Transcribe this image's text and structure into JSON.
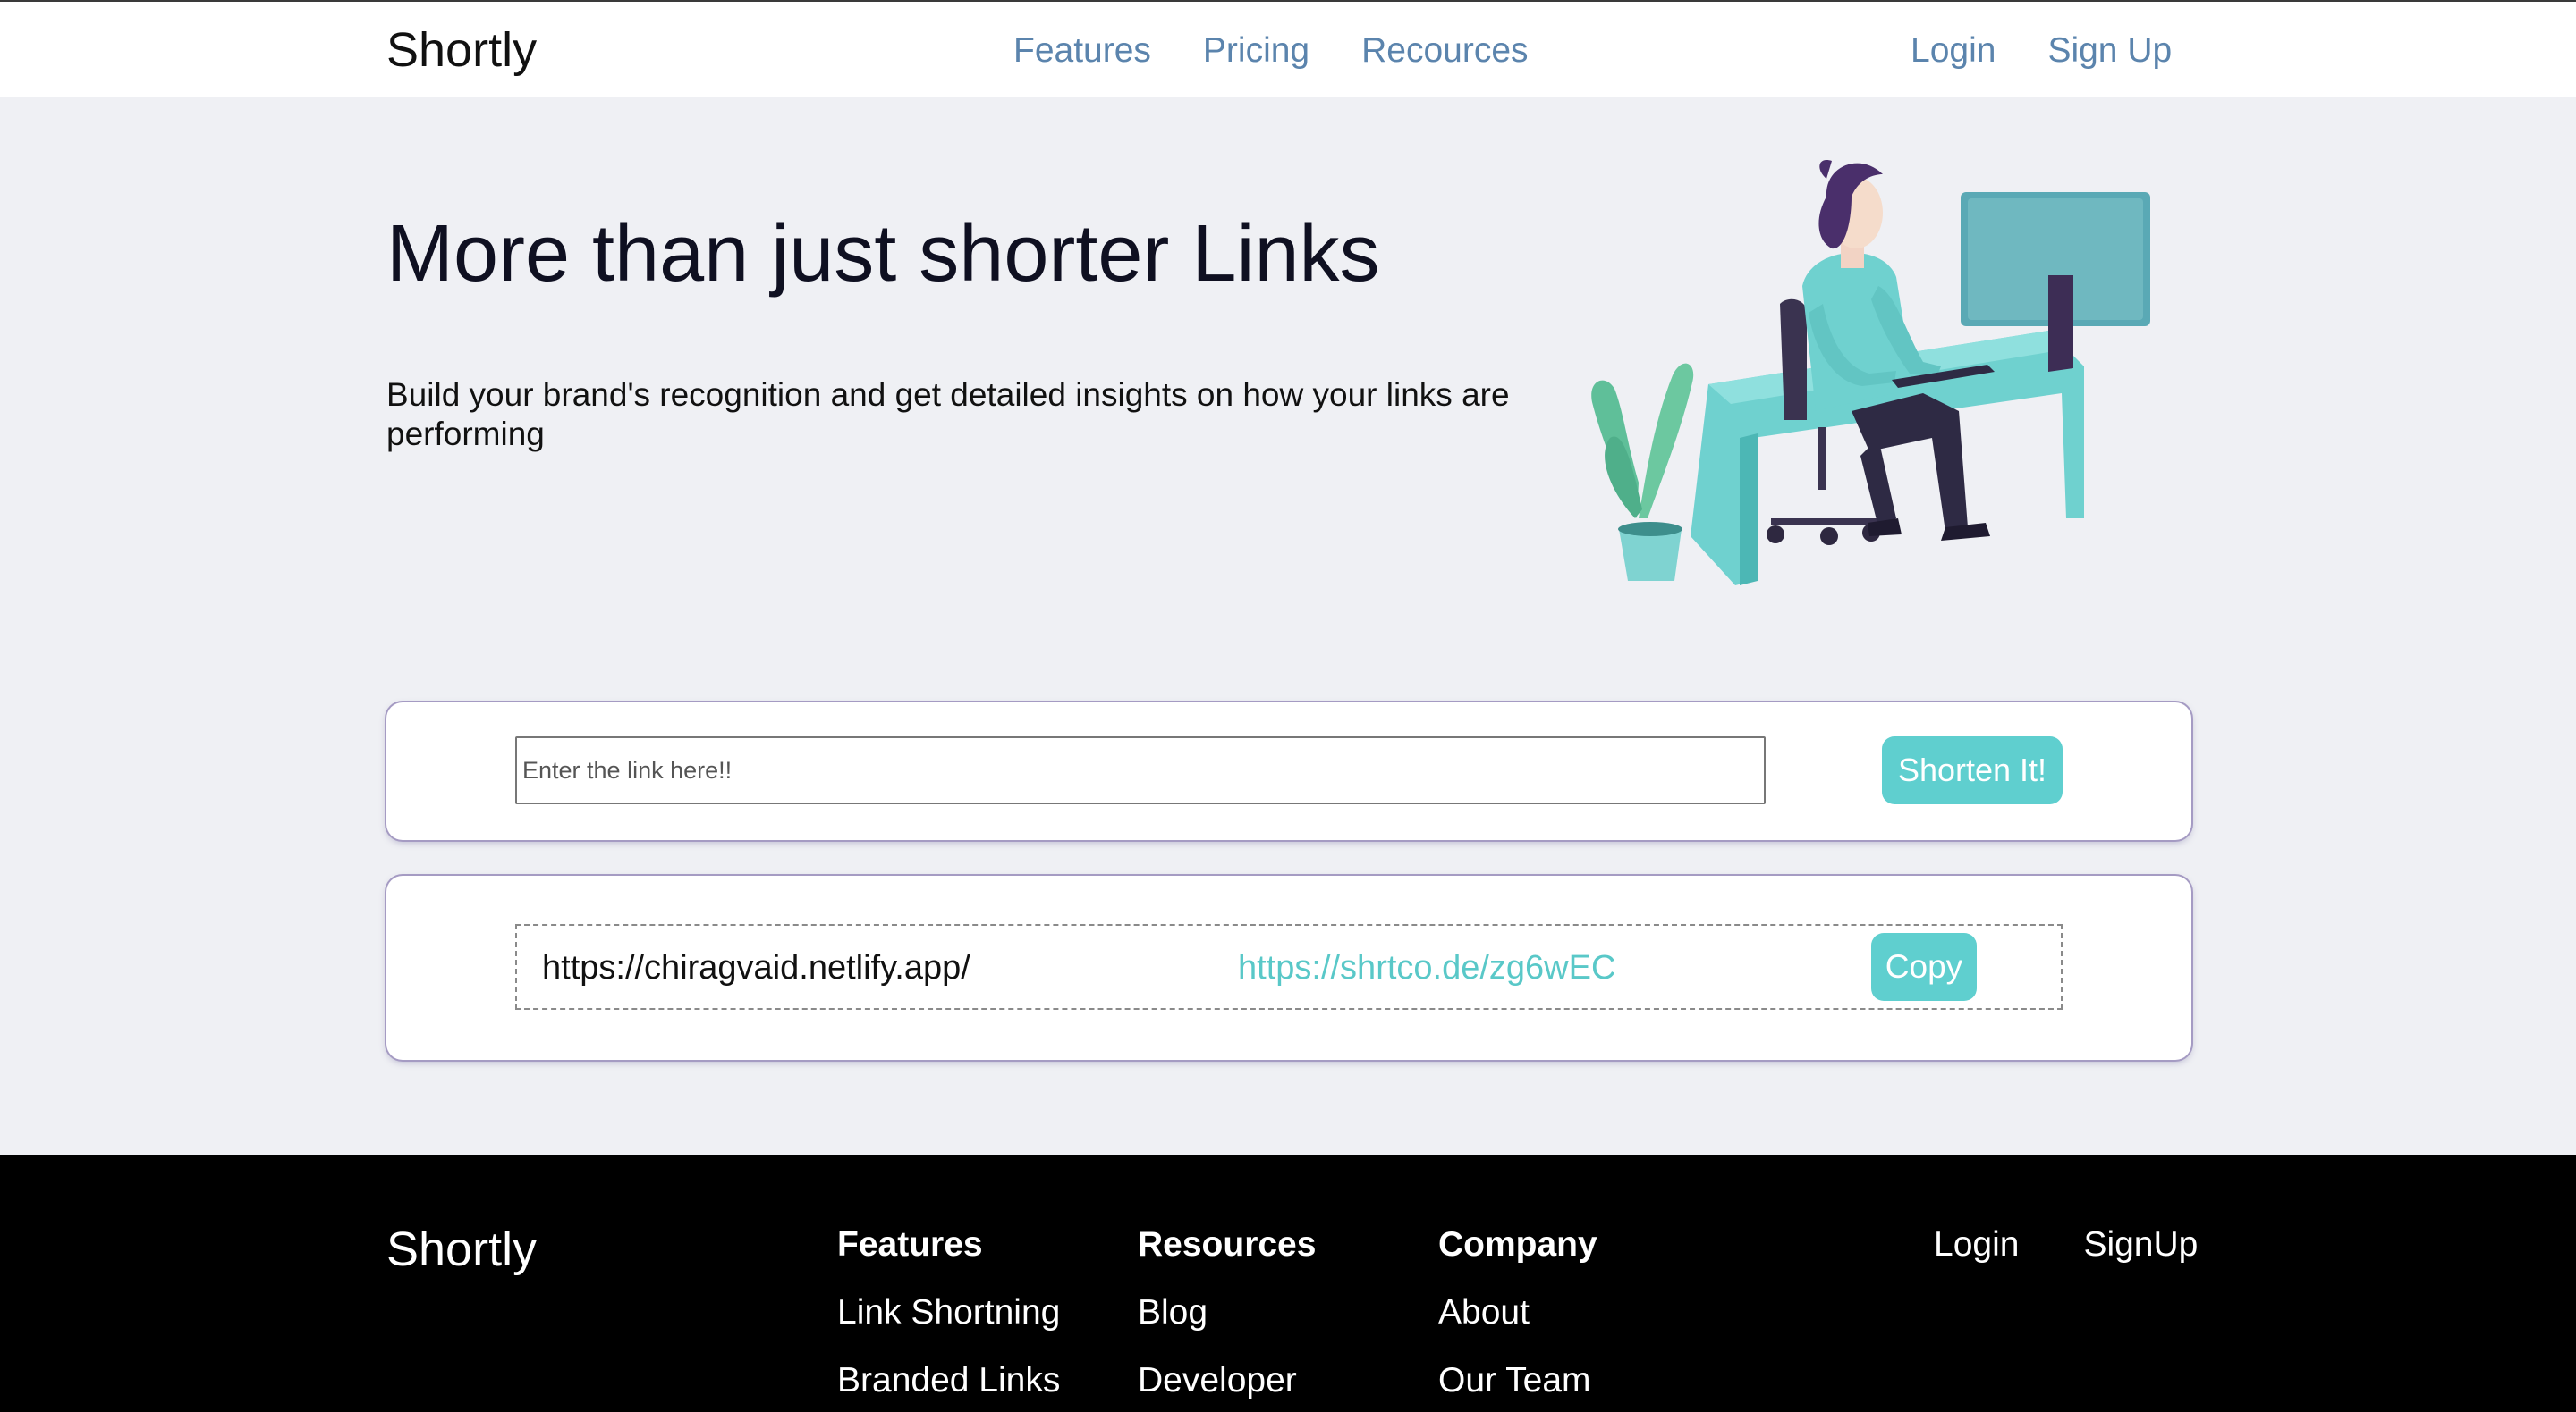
{
  "header": {
    "brand": "Shortly",
    "nav": [
      "Features",
      "Pricing",
      "Recources"
    ],
    "login": "Login",
    "signup": "Sign Up"
  },
  "hero": {
    "title": "More than just shorter Links",
    "subtitle": "Build your brand's recognition and get detailed insights on how your links are performing",
    "illustration": "person-working-at-desk-illustration"
  },
  "shorten": {
    "placeholder": "Enter the link here!!",
    "value": "",
    "button": "Shorten It!"
  },
  "results": [
    {
      "original": "https://chiragvaid.netlify.app/",
      "short": "https://shrtco.de/zg6wEC",
      "copy_label": "Copy"
    }
  ],
  "footer": {
    "brand": "Shortly",
    "columns": [
      {
        "heading": "Features",
        "items": [
          "Link Shortning",
          "Branded Links"
        ]
      },
      {
        "heading": "Resources",
        "items": [
          "Blog",
          "Developer"
        ]
      },
      {
        "heading": "Company",
        "items": [
          "About",
          "Our Team"
        ]
      }
    ],
    "login": "Login",
    "signup": "SignUp"
  },
  "colors": {
    "accent": "#5fcfcf",
    "nav_link": "#5b84ad",
    "page_bg": "#eff0f4",
    "footer_bg": "#000000"
  }
}
